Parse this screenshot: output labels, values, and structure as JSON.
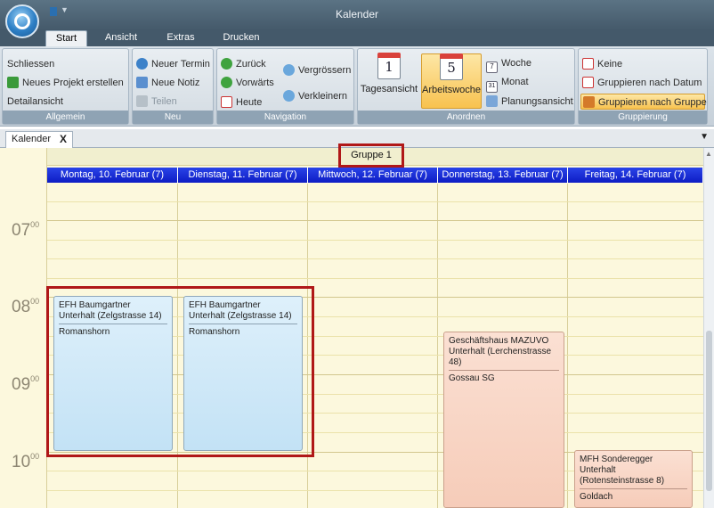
{
  "window": {
    "title": "Kalender"
  },
  "ribbon_tabs": [
    "Start",
    "Ansicht",
    "Extras",
    "Drucken"
  ],
  "groups": {
    "allgemein": {
      "label": "Allgemein",
      "items": [
        "Schliessen",
        "Neues Projekt erstellen",
        "Detailansicht"
      ]
    },
    "neu": {
      "label": "Neu",
      "items": [
        "Neuer Termin",
        "Neue Notiz",
        "Teilen"
      ]
    },
    "navigation": {
      "label": "Navigation",
      "items": [
        "Zurück",
        "Vorwärts",
        "Heute",
        "Vergrössern",
        "Verkleinern"
      ]
    },
    "anordnen": {
      "label": "Anordnen",
      "tagesansicht": "Tagesansicht",
      "tagesansicht_num": "1",
      "arbeitswoche": "Arbeitswoche",
      "arbeitswoche_num": "5",
      "woche": "Woche",
      "woche_num": "7",
      "monat": "Monat",
      "monat_num": "31",
      "planungsansicht": "Planungsansicht"
    },
    "gruppierung": {
      "label": "Gruppierung",
      "items": [
        "Keine",
        "Gruppieren nach Datum",
        "Gruppieren nach Gruppe"
      ]
    }
  },
  "doc_tab": {
    "label": "Kalender",
    "close": "X"
  },
  "calendar": {
    "group": "Gruppe 1",
    "days": [
      "Montag, 10. Februar (7)",
      "Dienstag, 11. Februar (7)",
      "Mittwoch, 12. Februar (7)",
      "Donnerstag, 13. Februar (7)",
      "Freitag, 14. Februar (7)"
    ],
    "hours": [
      {
        "h": "07",
        "m": "00"
      },
      {
        "h": "08",
        "m": "00"
      },
      {
        "h": "09",
        "m": "00"
      },
      {
        "h": "10",
        "m": "00"
      }
    ],
    "appointments": [
      {
        "title": "EFH Baumgartner Unterhalt (Zelgstrasse 14)",
        "location": "Romanshorn"
      },
      {
        "title": "EFH Baumgartner Unterhalt (Zelgstrasse 14)",
        "location": "Romanshorn"
      },
      {
        "title": "Geschäftshaus MAZUVO Unterhalt (Lerchenstrasse 48)",
        "location": "Gossau SG"
      },
      {
        "title": "MFH Sonderegger Unterhalt (Rotensteinstrasse 8)",
        "location": "Goldach"
      }
    ]
  },
  "colors": {
    "accent": "#1a2fd9",
    "appointment_blue": "#cfe8f8",
    "appointment_orange": "#f8d6c6",
    "highlight": "#b01818"
  }
}
